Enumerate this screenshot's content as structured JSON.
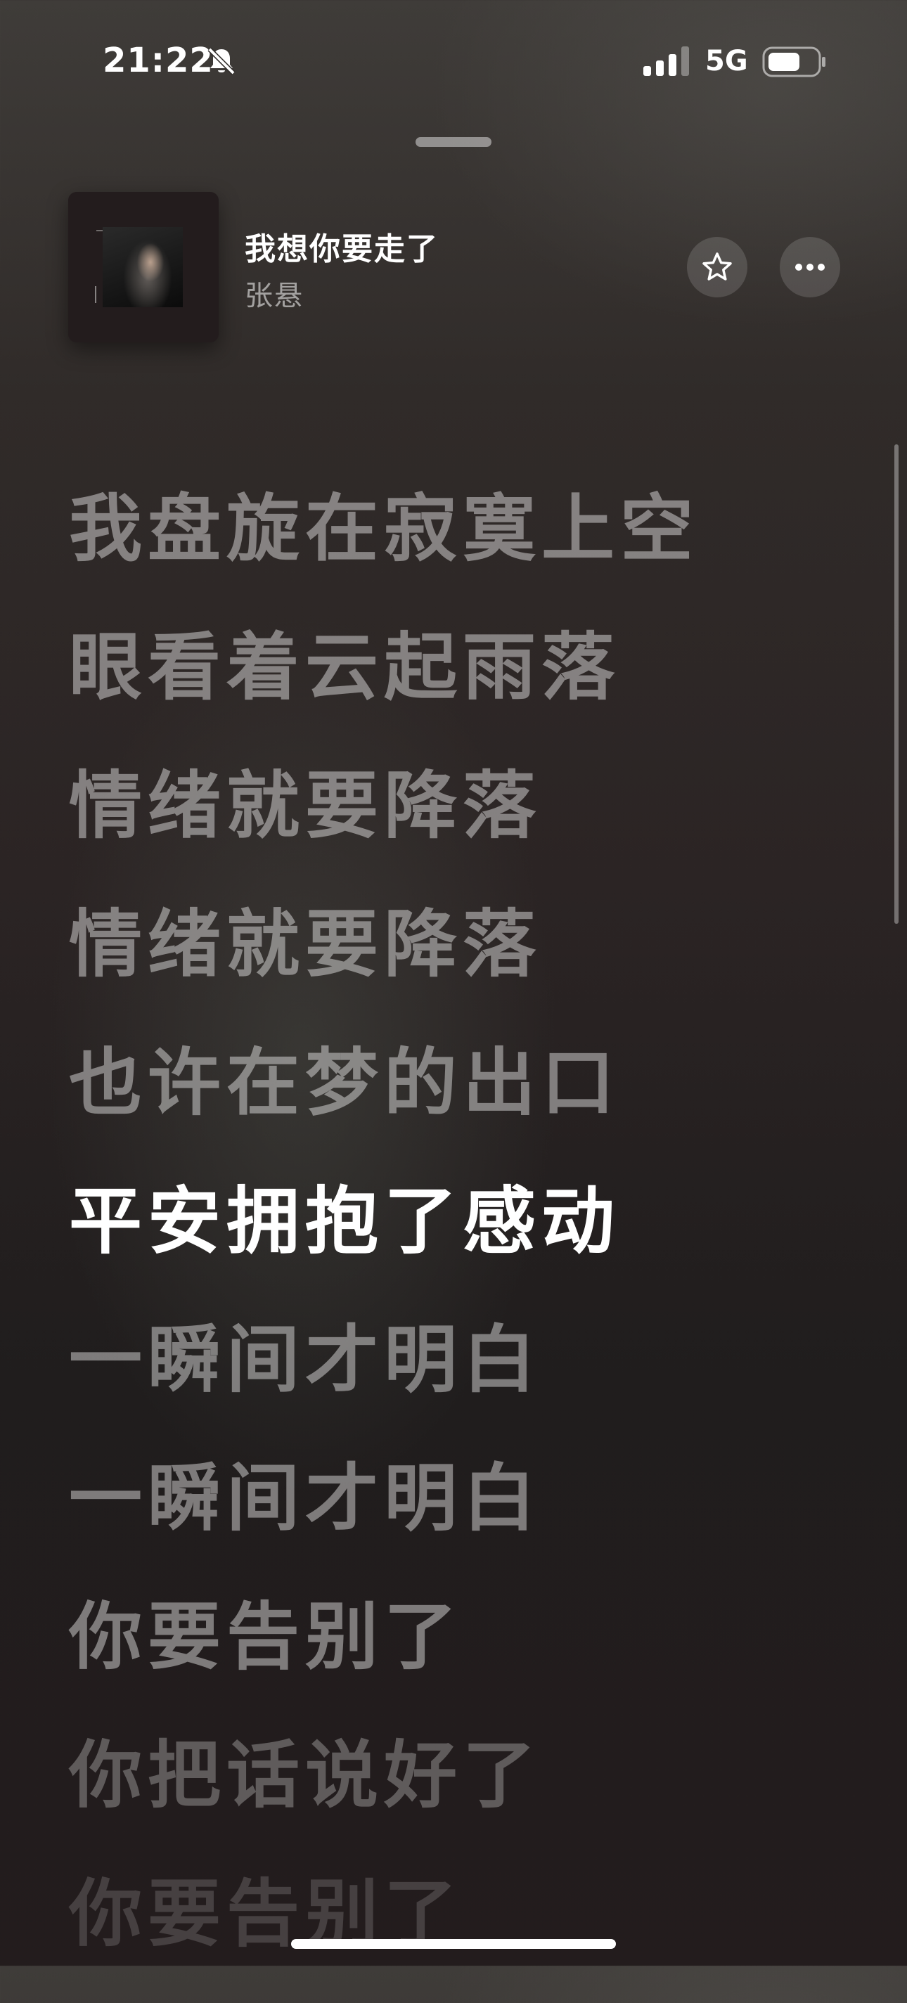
{
  "status_bar": {
    "time": "21:22",
    "network": "5G",
    "bell_icon": "bell-slash-icon",
    "signal_icon": "cellular-signal-icon",
    "battery_icon": "battery-icon"
  },
  "now_playing": {
    "title": "我想你要走了",
    "artist": "张悬",
    "favorite_icon": "star-outline-icon",
    "more_icon": "ellipsis-icon"
  },
  "lyrics": {
    "active_index": 5,
    "lines": [
      "我盘旋在寂寞上空",
      "眼看着云起雨落",
      "情绪就要降落",
      "情绪就要降落",
      "也许在梦的出口",
      "平安拥抱了感动",
      "一瞬间才明白",
      "一瞬间才明白",
      "你要告别了",
      "你把话说好了",
      "你要告别了"
    ]
  },
  "colors": {
    "active_lyric": "#ffffff",
    "inactive_lyric": "#8a8786",
    "background_top": "#3f3c39",
    "background_bottom": "#231c1d"
  }
}
